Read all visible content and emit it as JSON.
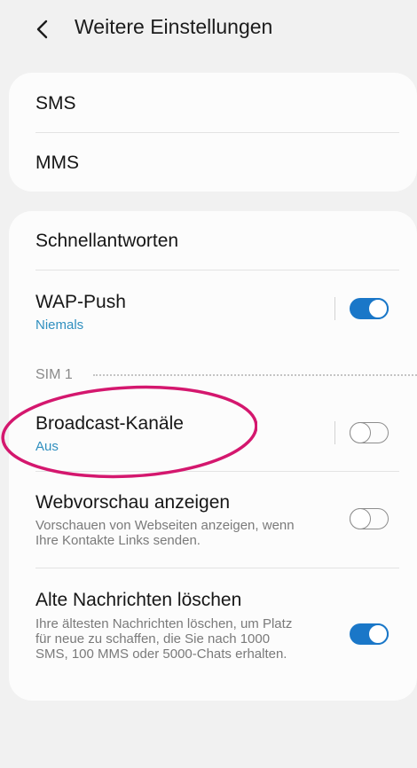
{
  "header": {
    "title": "Weitere Einstellungen"
  },
  "card1": {
    "items": [
      {
        "label": "SMS"
      },
      {
        "label": "MMS"
      }
    ]
  },
  "card2": {
    "quick_replies": {
      "label": "Schnellantworten"
    },
    "wap_push": {
      "label": "WAP-Push",
      "value": "Niemals",
      "enabled": true
    },
    "sim_section": {
      "label": "SIM 1"
    },
    "broadcast": {
      "label": "Broadcast-Kanäle",
      "value": "Aus",
      "enabled": false
    },
    "web_preview": {
      "label": "Webvorschau anzeigen",
      "description": "Vorschauen von Webseiten anzeigen, wenn Ihre Kontakte Links senden.",
      "enabled": false
    },
    "delete_old": {
      "label": "Alte Nachrichten löschen",
      "description": "Ihre ältesten Nachrichten löschen, um Platz für neue zu schaffen, die Sie nach 1000 SMS, 100 MMS oder 5000-Chats erhalten.",
      "enabled": true
    }
  },
  "colors": {
    "background": "#f1f1f1",
    "card": "#fcfcfc",
    "accent": "#1a77c8",
    "subtext_blue": "#2f8fbf",
    "highlight_ring": "#d4176e"
  },
  "icons": {
    "back": "chevron-left-icon"
  }
}
